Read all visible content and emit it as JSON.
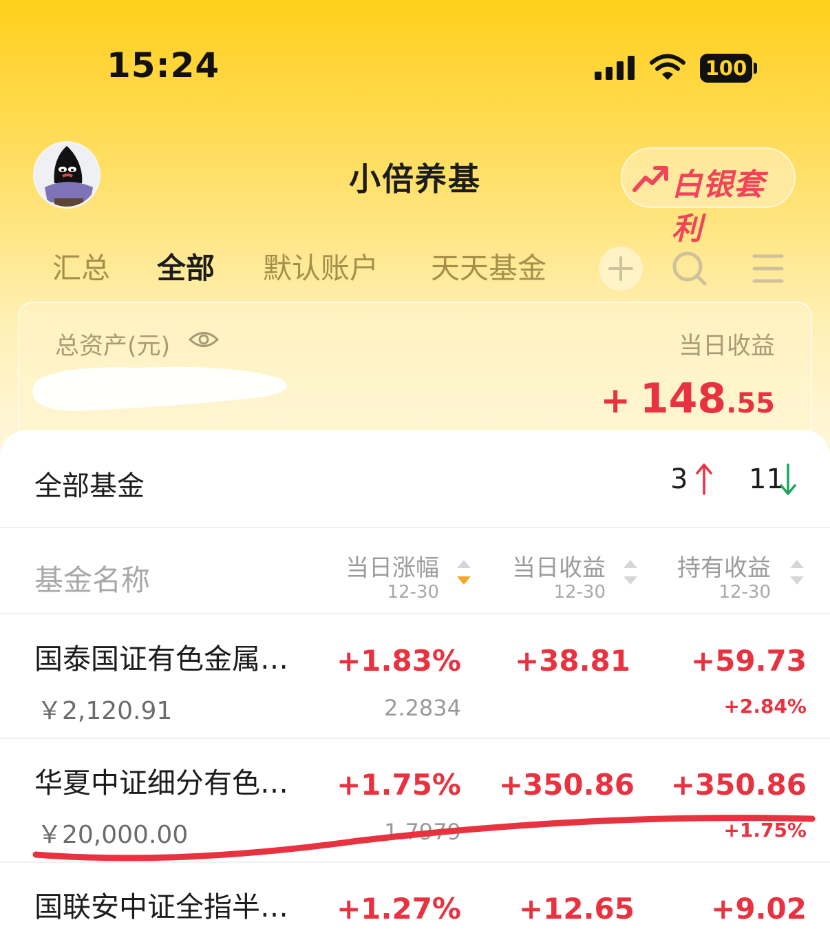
{
  "status_bar": {
    "time": "15:24",
    "battery": "100"
  },
  "header": {
    "title": "小倍养基",
    "promo_label": "白银套利"
  },
  "tabs": [
    {
      "label": "汇总"
    },
    {
      "label": "全部"
    },
    {
      "label": "默认账户"
    },
    {
      "label": "天天基金"
    }
  ],
  "summary": {
    "total_assets_label": "总资产(元)",
    "daily_profit_label": "当日收益",
    "daily_profit_sign": "+",
    "daily_profit_int": "148",
    "daily_profit_dec": ".55"
  },
  "fund_list": {
    "title": "全部基金",
    "up_count": "3",
    "down_count": "11",
    "columns": {
      "name": "基金名称",
      "daily_change": "当日涨幅",
      "daily_profit": "当日收益",
      "holding_profit": "持有收益",
      "date": "12-30"
    },
    "rows": [
      {
        "name": "国泰国证有色金属…",
        "amount": "￥2,120.91",
        "daily_change": "+1.83%",
        "nav": "2.2834",
        "daily_profit": "+38.81",
        "holding_profit": "+59.73",
        "holding_rate": "+2.84%"
      },
      {
        "name": "华夏中证细分有色…",
        "amount": "￥20,000.00",
        "daily_change": "+1.75%",
        "nav": "1.7979",
        "daily_profit": "+350.86",
        "holding_profit": "+350.86",
        "holding_rate": "+1.75%"
      },
      {
        "name": "国联安中证全指半…",
        "daily_change": "+1.27%",
        "daily_profit": "+12.65",
        "holding_profit": "+9.02"
      }
    ]
  }
}
